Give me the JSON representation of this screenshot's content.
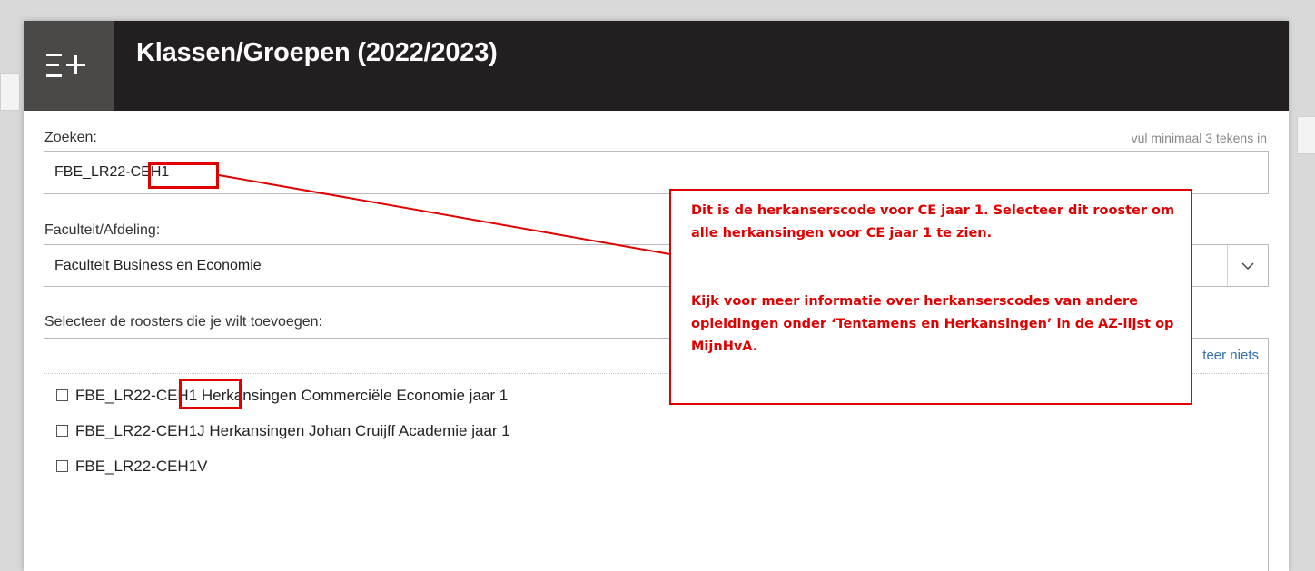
{
  "dialog": {
    "title": "Klassen/Groepen (2022/2023)",
    "icon": "list-add-icon"
  },
  "search": {
    "label": "Zoeken:",
    "hint": "vul minimaal 3 tekens in",
    "value": "FBE_LR22-CEH1"
  },
  "faculty": {
    "label": "Faculteit/Afdeling:",
    "value": "Faculteit Business en Economie"
  },
  "roosters": {
    "label": "Selecteer de roosters die je wilt toevoegen:",
    "select_none_visible": "teer niets",
    "items": [
      {
        "code": "FBE_LR22-CEH1",
        "desc": "Herkansingen Commerciële Economie jaar 1",
        "text": "FBE_LR22-CEH1 Herkansingen Commerciële Economie jaar 1"
      },
      {
        "code": "FBE_LR22-CEH1J",
        "desc": "Herkansingen Johan Cruijff Academie jaar 1",
        "text": "FBE_LR22-CEH1J Herkansingen Johan Cruijff Academie jaar 1"
      },
      {
        "code": "FBE_LR22-CEH1V",
        "desc": "",
        "text": "FBE_LR22-CEH1V"
      }
    ]
  },
  "annotation": {
    "color": "#e00000",
    "para1": "Dit is de herkanserscode voor CE jaar 1. Selecteer dit rooster om alle herkansingen voor CE jaar 1 te zien.",
    "para2": "Kijk voor meer informatie over herkanserscodes van andere opleidingen onder ‘Tentamens en Herkansingen’ in de AZ-lijst op MijnHvA."
  }
}
